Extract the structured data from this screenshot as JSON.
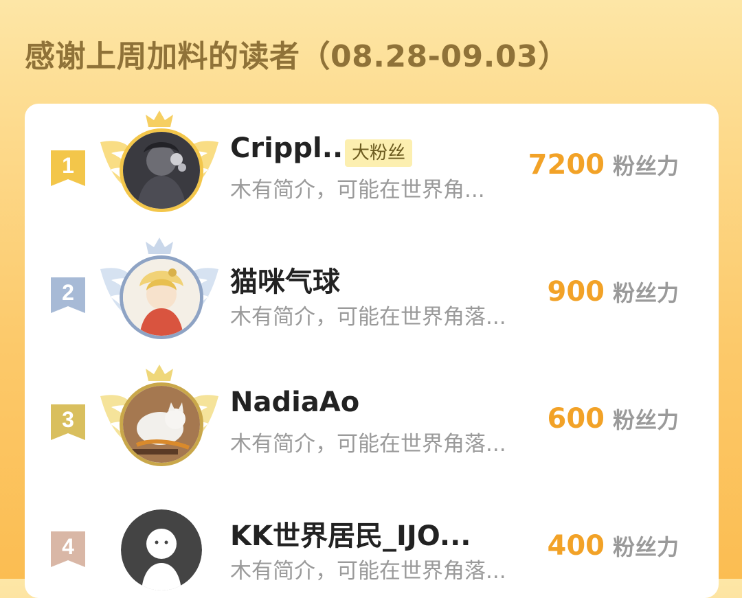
{
  "page": {
    "title": "感谢上周加料的读者（08.28-09.03）"
  },
  "colors": {
    "accent": "#f2a227",
    "gold": "#f3c64a",
    "silver": "#a7bad6",
    "bronze": "#d9bf5e",
    "rank4": "#d9b7a6"
  },
  "readers": [
    {
      "rank": "1",
      "name": "Crippl...",
      "badge": "大粉丝",
      "bio": "木有简介，可能在世界角...",
      "score": "7200",
      "score_unit": "粉丝力"
    },
    {
      "rank": "2",
      "name": "猫咪气球",
      "badge": "",
      "bio": "木有简介，可能在世界角落...",
      "score": "900",
      "score_unit": "粉丝力"
    },
    {
      "rank": "3",
      "name": "NadiaAo",
      "badge": "",
      "bio": "木有简介，可能在世界角落...",
      "score": "600",
      "score_unit": "粉丝力"
    },
    {
      "rank": "4",
      "name": "KK世界居民_IJO...",
      "badge": "",
      "bio": "木有简介，可能在世界角落...",
      "score": "400",
      "score_unit": "粉丝力"
    }
  ]
}
